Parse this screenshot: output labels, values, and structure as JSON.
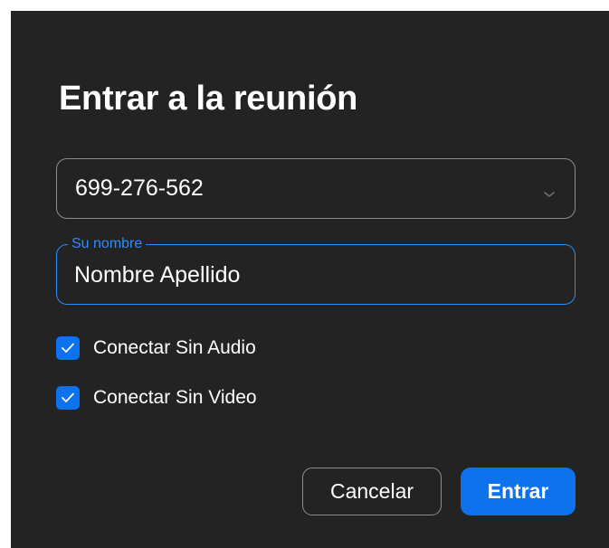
{
  "dialog": {
    "title": "Entrar a la reunión",
    "meeting_id": {
      "value": "699-276-562",
      "dropdown_icon": "chevron-down-icon"
    },
    "name_field": {
      "label": "Su nombre",
      "value": "Nombre Apellido"
    },
    "options": [
      {
        "label": "Conectar Sin Audio",
        "checked": true
      },
      {
        "label": "Conectar Sin Video",
        "checked": true
      }
    ],
    "buttons": {
      "cancel": "Cancelar",
      "join": "Entrar"
    }
  },
  "colors": {
    "background": "#232323",
    "accent": "#0e72ed",
    "focus_border": "#2d8cff",
    "border": "#8e8e8e",
    "text": "#ffffff"
  }
}
